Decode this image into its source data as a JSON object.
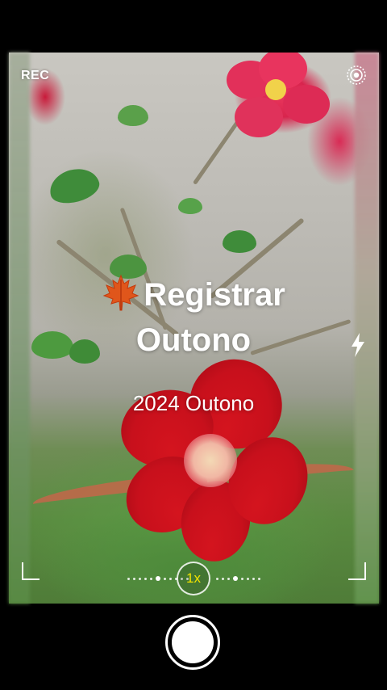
{
  "status": {
    "rec_label": "REC"
  },
  "overlay": {
    "title_emoji": "🍁",
    "title_line1": "Registrar",
    "title_line2": "Outono",
    "subtitle": "2024 Outono"
  },
  "camera": {
    "zoom_label": "1x",
    "zoom_color": "#f2e200"
  },
  "icons": {
    "settings": "live-photo-icon",
    "flash": "flash-icon",
    "leaf": "maple-leaf-icon"
  }
}
